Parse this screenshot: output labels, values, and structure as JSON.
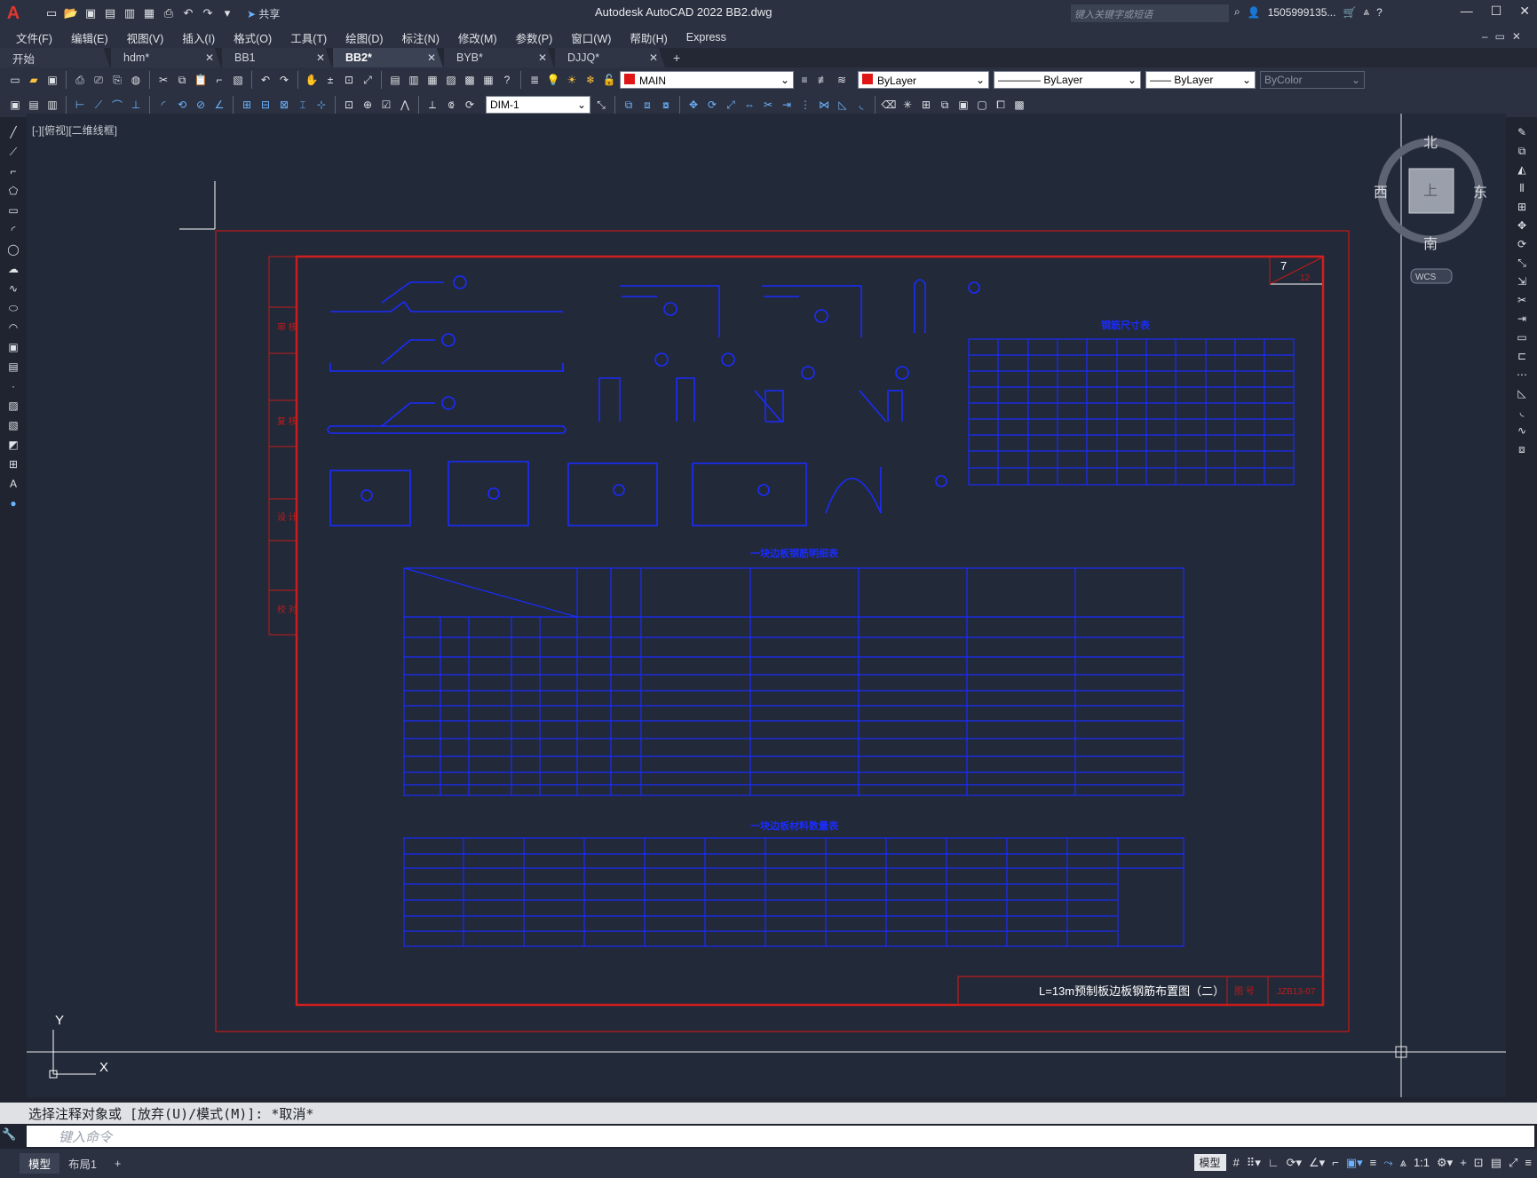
{
  "app": {
    "title": "Autodesk AutoCAD 2022    BB2.dwg",
    "share_label": "共享",
    "search_placeholder": "键入关键字或短语",
    "user": "1505999135...",
    "logo": "A"
  },
  "menu": [
    "文件(F)",
    "编辑(E)",
    "视图(V)",
    "插入(I)",
    "格式(O)",
    "工具(T)",
    "绘图(D)",
    "标注(N)",
    "修改(M)",
    "参数(P)",
    "窗口(W)",
    "帮助(H)",
    "Express"
  ],
  "tabs": [
    {
      "label": "开始",
      "close": ""
    },
    {
      "label": "hdm*",
      "close": "✕"
    },
    {
      "label": "BB1",
      "close": "✕"
    },
    {
      "label": "BB2*",
      "close": "✕"
    },
    {
      "label": "BYB*",
      "close": "✕"
    },
    {
      "label": "DJJQ*",
      "close": "✕"
    }
  ],
  "layer_combo": "MAIN",
  "color_combo": "ByLayer",
  "linetype_combo": "ByLayer",
  "lineweight_combo": "ByLayer",
  "plotstyle_combo": "ByColor",
  "dimstyle_combo": "DIM-1",
  "viewport_label": "[-][俯视][二维线框]",
  "viewcube": {
    "north": "北",
    "south": "南",
    "east": "东",
    "west": "西",
    "face": "上",
    "wcs": "WCS"
  },
  "ucs": {
    "x": "X",
    "y": "Y"
  },
  "drawing": {
    "sheet_number": "7",
    "sheet_total": "12",
    "title_block_text": "L=13m预制板边板钢筋布置图（二）",
    "title_block_label": "图  号",
    "drawing_code": "JZB13-07",
    "table_title_1": "钢筋尺寸表",
    "table_title_2": "一块边板钢筋明细表",
    "table_title_3": "一块边板材料数量表",
    "side_labels": [
      "审 核",
      "复 核",
      "设 计",
      "校 对"
    ]
  },
  "command": {
    "history": "选择注释对象或 [放弃(U)/模式(M)]: *取消*",
    "placeholder": "键入命令"
  },
  "status": {
    "layout_tabs": [
      "模型",
      "布局1"
    ],
    "model_label": "模型",
    "scale": "1:1"
  }
}
